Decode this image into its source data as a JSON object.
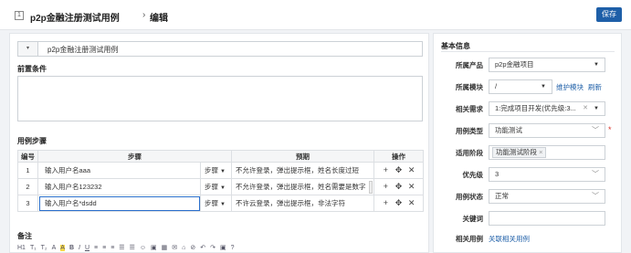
{
  "header": {
    "id_badge": "1",
    "title": "p2p金融注册测试用例",
    "separator": "›",
    "subtitle": "编辑",
    "save_label": "保存"
  },
  "main": {
    "case_title": "p2p金融注册测试用例",
    "toggle_icon": "▾",
    "precondition_label": "前置条件",
    "precondition_value": "",
    "steps_label": "用例步骤",
    "columns": {
      "num": "编号",
      "step": "步骤",
      "expect": "预期",
      "ops": "操作"
    },
    "rows": [
      {
        "num": "1",
        "step": "输入用户名aaa",
        "type": "步骤",
        "expect": "不允许登录，弹出提示框，姓名长度过短"
      },
      {
        "num": "2",
        "step": "输入用户名123232",
        "type": "步骤",
        "expect": "不允许登录，弹出提示框，姓名需要是数字"
      },
      {
        "num": "3",
        "step": "输入用户名*dsdd",
        "type": "步骤",
        "expect": "不许云登录，弹出提示框，非法字符"
      }
    ],
    "notes_label": "备注",
    "editor_toolbar": [
      "H1",
      "T₁",
      "T₂",
      "A",
      "A",
      "B",
      "I",
      "U",
      "≡",
      "≡",
      "≡",
      "☰",
      "☰",
      "☺",
      "▣",
      "▦",
      "✉",
      "⌂",
      "⊘",
      "↶",
      "↷",
      "▣",
      "?"
    ]
  },
  "sidebar": {
    "title": "基本信息",
    "fields": [
      {
        "label": "所属产品",
        "value": "p2p金融项目"
      },
      {
        "label": "所属模块",
        "value": "/",
        "links": [
          "维护模块",
          "刷新"
        ]
      },
      {
        "label": "相关需求",
        "value": "1:完成项目开发(优先级:3..."
      },
      {
        "label": "用例类型",
        "value": "功能测试"
      },
      {
        "label": "适用阶段",
        "value": "功能测试阶段"
      },
      {
        "label": "优先级",
        "value": "3"
      },
      {
        "label": "用例状态",
        "value": "正常"
      },
      {
        "label": "关键词",
        "value": ""
      },
      {
        "label": "相关用例",
        "value": "关联相关用例"
      }
    ]
  }
}
